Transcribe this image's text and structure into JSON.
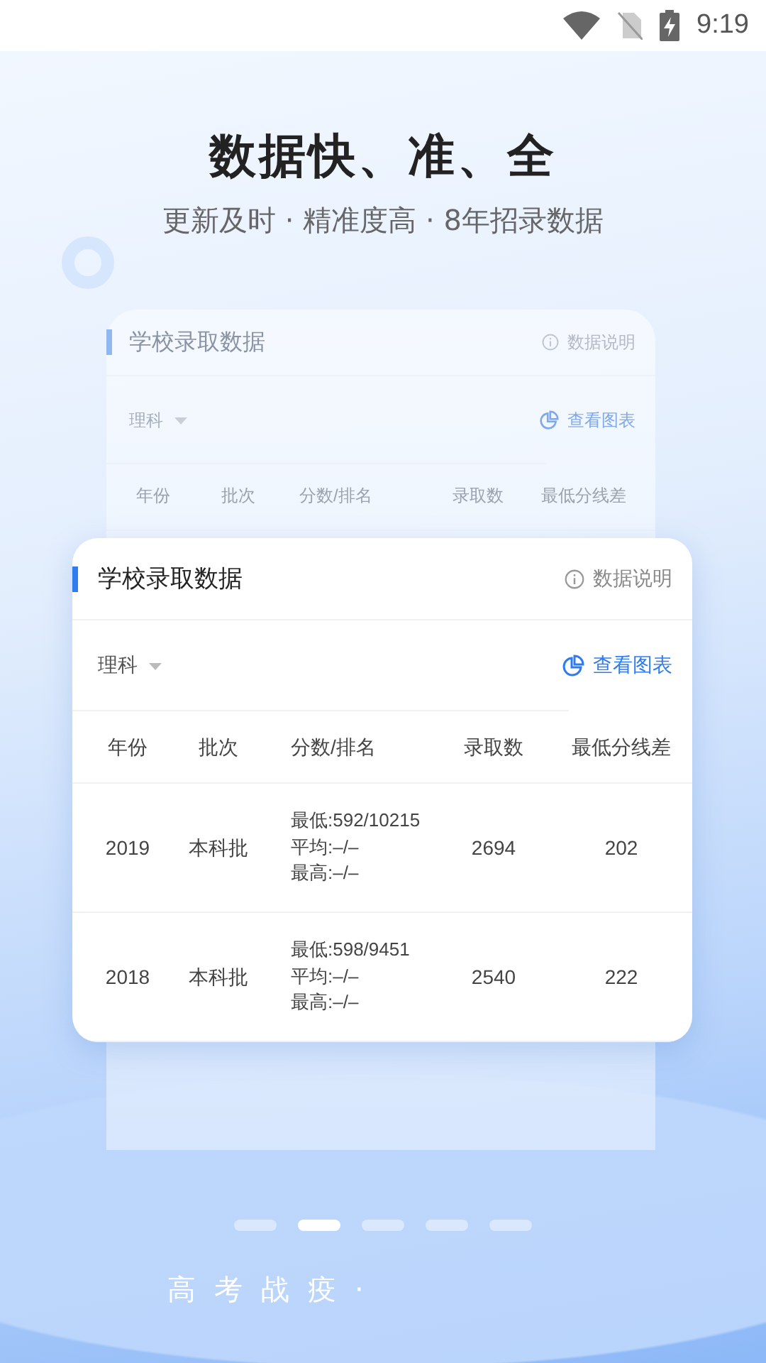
{
  "status_bar": {
    "time": "9:19"
  },
  "headline": "数据快、准、全",
  "subheadline": "更新及时 · 精准度高 · 8年招录数据",
  "back_card": {
    "title": "学校录取数据",
    "info_link": "数据说明",
    "filter": "理科",
    "chart_link": "查看图表",
    "columns": [
      "年份",
      "批次",
      "分数/排名",
      "录取数",
      "最低分线差"
    ]
  },
  "front_card": {
    "title": "学校录取数据",
    "info_link": "数据说明",
    "filter": "理科",
    "chart_link": "查看图表",
    "columns": [
      "年份",
      "批次",
      "分数/排名",
      "录取数",
      "最低分线差"
    ],
    "rows": [
      {
        "year": "2019",
        "batch": "本科批",
        "scores": [
          "最低:592/10215",
          "平均:–/–",
          "最高:–/–"
        ],
        "admitted": "2694",
        "diff": "202"
      },
      {
        "year": "2018",
        "batch": "本科批",
        "scores": [
          "最低:598/9451",
          "平均:–/–",
          "最高:–/–"
        ],
        "admitted": "2540",
        "diff": "222"
      }
    ]
  },
  "pager": [
    {
      "selected": false
    },
    {
      "selected": true
    },
    {
      "selected": false
    },
    {
      "selected": false
    },
    {
      "selected": false
    }
  ],
  "footer_text": "高考战疫·"
}
